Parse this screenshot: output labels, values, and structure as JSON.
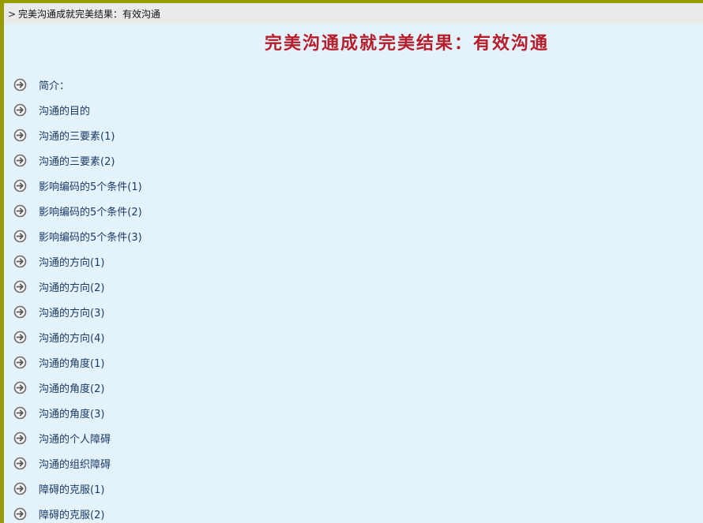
{
  "breadcrumb": {
    "icon": "chevron-right-icon",
    "text": "完美沟通成就完美结果：有效沟通"
  },
  "page": {
    "title": "完美沟通成就完美结果：有效沟通",
    "title_color": "#b51d2a",
    "background": "#e4f3fb",
    "border_color": "#999900"
  },
  "toc": {
    "item_icon": "circle-arrow-right-icon",
    "items": [
      {
        "label": "简介："
      },
      {
        "label": "沟通的目的"
      },
      {
        "label": "沟通的三要素(1)"
      },
      {
        "label": "沟通的三要素(2)"
      },
      {
        "label": "影响编码的5个条件(1)"
      },
      {
        "label": "影响编码的5个条件(2)"
      },
      {
        "label": "影响编码的5个条件(3)"
      },
      {
        "label": "沟通的方向(1)"
      },
      {
        "label": "沟通的方向(2)"
      },
      {
        "label": "沟通的方向(3)"
      },
      {
        "label": "沟通的方向(4)"
      },
      {
        "label": "沟通的角度(1)"
      },
      {
        "label": "沟通的角度(2)"
      },
      {
        "label": "沟通的角度(3)"
      },
      {
        "label": "沟通的个人障碍"
      },
      {
        "label": "沟通的组织障碍"
      },
      {
        "label": "障碍的克服(1)"
      },
      {
        "label": "障碍的克服(2)"
      }
    ]
  }
}
